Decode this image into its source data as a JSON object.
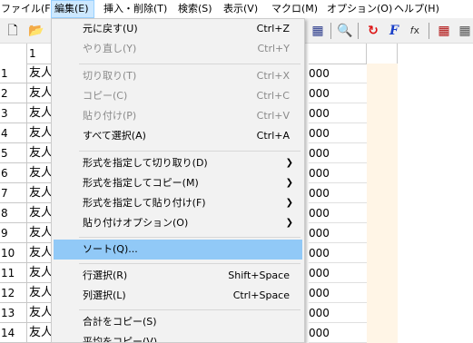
{
  "menubar": [
    "ファイル(F)",
    "編集(E)",
    "挿入・削除(T)",
    "検索(S)",
    "表示(V)",
    "マクロ(M)",
    "オプション(O)",
    "ヘルプ(H)"
  ],
  "grid": {
    "col_header": "1",
    "row_numbers": [
      "1",
      "2",
      "3",
      "4",
      "5",
      "6",
      "7",
      "8",
      "9",
      "10",
      "11",
      "12",
      "13",
      "14"
    ],
    "cell_text": "友人",
    "right_text": "000"
  },
  "edit_menu": {
    "items": [
      {
        "label": "元に戻す(U)",
        "shortcut": "Ctrl+Z",
        "disabled": false
      },
      {
        "label": "やり直し(Y)",
        "shortcut": "Ctrl+Y",
        "disabled": true
      },
      {
        "label": "切り取り(T)",
        "shortcut": "Ctrl+X",
        "disabled": true
      },
      {
        "label": "コピー(C)",
        "shortcut": "Ctrl+C",
        "disabled": true
      },
      {
        "label": "貼り付け(P)",
        "shortcut": "Ctrl+V",
        "disabled": true
      },
      {
        "label": "すべて選択(A)",
        "shortcut": "Ctrl+A",
        "disabled": false
      },
      {
        "label": "形式を指定して切り取り(D)",
        "shortcut": "",
        "submenu": true
      },
      {
        "label": "形式を指定してコピー(M)",
        "shortcut": "",
        "submenu": true
      },
      {
        "label": "形式を指定して貼り付け(F)",
        "shortcut": "",
        "submenu": true
      },
      {
        "label": "貼り付けオプション(O)",
        "shortcut": "",
        "submenu": true
      },
      {
        "label": "ソート(Q)...",
        "shortcut": "",
        "highlighted": true
      },
      {
        "label": "行選択(R)",
        "shortcut": "Shift+Space"
      },
      {
        "label": "列選択(L)",
        "shortcut": "Ctrl+Space"
      },
      {
        "label": "合計をコピー(S)",
        "shortcut": ""
      },
      {
        "label": "平均をコピー(V)",
        "shortcut": ""
      }
    ]
  }
}
